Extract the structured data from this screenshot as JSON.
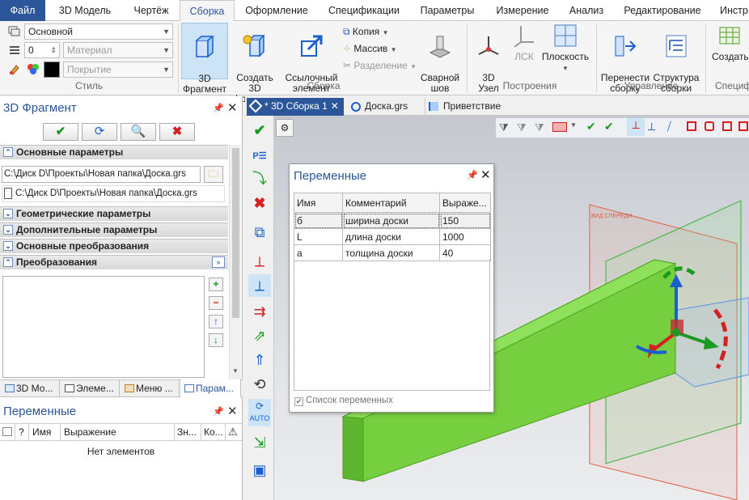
{
  "menu": {
    "tabs": [
      "Файл",
      "3D Модель",
      "Чертёж",
      "Сборка",
      "Оформление",
      "Спецификации",
      "Параметры",
      "Измерение",
      "Анализ",
      "Редактирование",
      "Инстр"
    ]
  },
  "ribbon": {
    "style": {
      "layer_value": "Основной",
      "number_value": "0",
      "material_placeholder": "Материал",
      "coating_placeholder": "Покрытие",
      "group_label": "Стиль"
    },
    "assembly": {
      "fragment3d": "3D\nФрагмент",
      "create3d": "Создать 3D\nфрагмент",
      "linked": "Ссылочный\nэлемент",
      "copy": "Копия",
      "array": "Массив",
      "split": "Разделение",
      "weld": "Сварной\nшов",
      "group_label": "Сборка"
    },
    "build": {
      "node3d": "3D\nУзел",
      "lsk": "ЛСК",
      "plane": "Плоскость",
      "group_label": "Построения"
    },
    "manage": {
      "move": "Перенести\nсборку",
      "structure": "Структура\nсборки",
      "group_label": "Управление"
    },
    "spec": {
      "create": "Создать",
      "group_label": "Специф"
    }
  },
  "doc_tabs": [
    {
      "label": "* 3D Сборка 1"
    },
    {
      "label": "Доска.grs"
    },
    {
      "label": "Приветствие"
    }
  ],
  "left_panel": {
    "title": "3D Фрагмент",
    "section_main": "Основные параметры",
    "path1": "C:\\Диск D\\Проекты\\Новая папка\\Доска.grs",
    "path2": "C:\\Диск D\\Проекты\\Новая папка\\Доска.grs",
    "section_geom": "Геометрические параметры",
    "section_extra": "Дополнительные параметры",
    "section_transforms_main": "Основные преобразования",
    "section_transforms": "Преобразования",
    "bottom_tabs": [
      "3D Мо...",
      "Элеме...",
      "Меню ...",
      "Парам..."
    ]
  },
  "variables_panel": {
    "title": "Переменные",
    "col_q": "?",
    "col_name": "Имя",
    "col_expr": "Выражение",
    "col_val": "Зн...",
    "col_comment": "Ко...",
    "empty_text": "Нет элементов"
  },
  "variables_dialog": {
    "title": "Переменные",
    "headers": {
      "name": "Имя",
      "comment": "Комментарий",
      "expr": "Выраже..."
    },
    "rows": [
      {
        "name": "б",
        "comment": "ширина доски",
        "expr": "150"
      },
      {
        "name": "L",
        "comment": "длина доски",
        "expr": "1000"
      },
      {
        "name": "a",
        "comment": "толщина доски",
        "expr": "40"
      }
    ],
    "checkbox_label": "Список переменных"
  },
  "vtoolbar": {
    "auto_label": "AUTO"
  },
  "colors": {
    "accent": "#2b579a",
    "board_green": "#6fcf3a",
    "plane_red": "#e06040",
    "plane_green": "#4fb84f",
    "axis_blue": "#1a5fd0"
  }
}
